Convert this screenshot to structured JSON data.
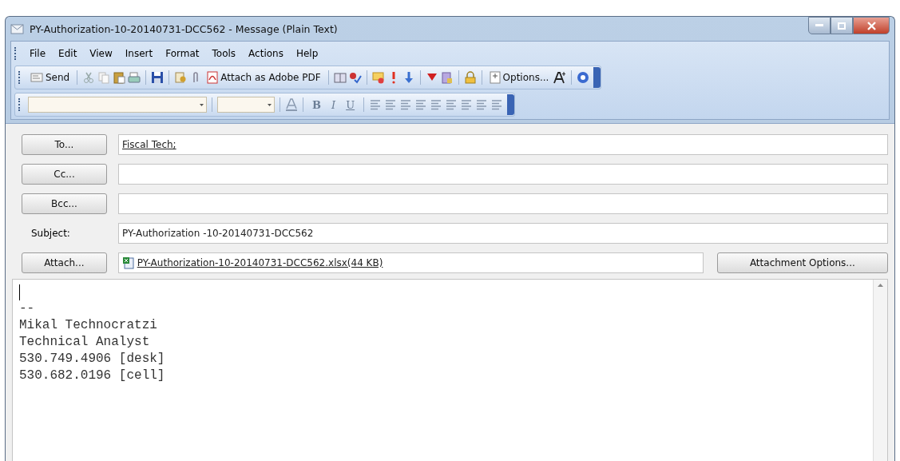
{
  "window": {
    "title": "PY-Authorization-10-20140731-DCC562 - Message (Plain Text)"
  },
  "menu": [
    "File",
    "Edit",
    "View",
    "Insert",
    "Format",
    "Tools",
    "Actions",
    "Help"
  ],
  "toolbar": {
    "send": "Send",
    "attach_pdf": "Attach as Adobe PDF",
    "options": "Options..."
  },
  "format_buttons": [
    "B",
    "I",
    "U"
  ],
  "fields": [
    {
      "kind": "button",
      "label": "To...",
      "value": "Fiscal Tech;"
    },
    {
      "kind": "button",
      "label": "Cc..."
    },
    {
      "kind": "button",
      "label": "Bcc..."
    },
    {
      "kind": "label",
      "label": "Subject:",
      "value": "PY-Authorization -10-20140731-DCC562"
    }
  ],
  "attach": {
    "label": "Attach...",
    "file": "PY-Authorization-10-20140731-DCC562.xlsx(44 KB)",
    "options": "Attachment Options..."
  },
  "body": [
    "--",
    "Mikal Technocratzi",
    "Technical Analyst",
    "530.749.4906 [desk]",
    "530.682.0196 [cell]"
  ]
}
